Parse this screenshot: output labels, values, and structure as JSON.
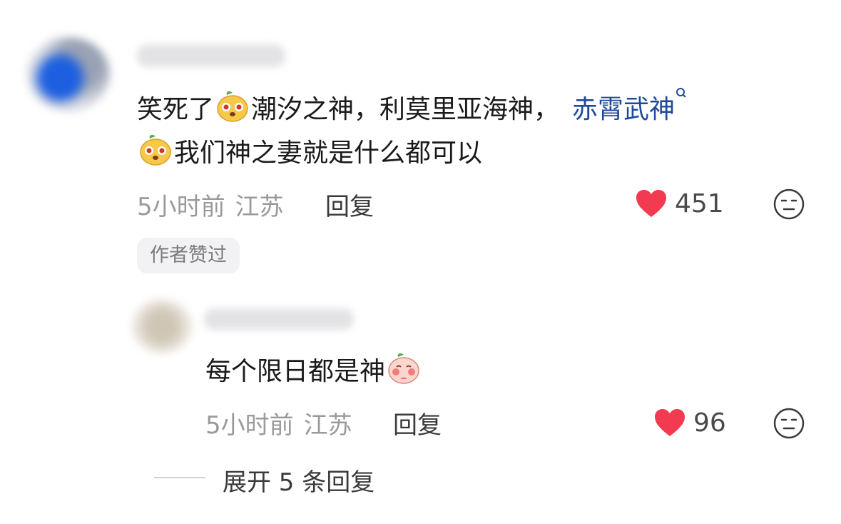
{
  "comment": {
    "text_prefix": "笑死了",
    "text_middle": "潮汐之神，利莫里亚海神，",
    "mention": "赤霄武神",
    "text_line2": "我们神之妻就是什么都可以",
    "time": "5小时前",
    "location": "江苏",
    "reply_label": "回复",
    "like_count": "451",
    "badge": "作者赞过",
    "emojis": [
      "yellow-bun-emoji",
      "yellow-bun-emoji",
      "pink-bun-emoji"
    ]
  },
  "reply": {
    "text": "每个限日都是神",
    "time": "5小时前",
    "location": "江苏",
    "reply_label": "回复",
    "like_count": "96"
  },
  "expand": {
    "label": "展开 5 条回复"
  },
  "colors": {
    "heart": "#f23a51",
    "mention": "#1f4a9c",
    "meta": "#9a9a9a"
  }
}
